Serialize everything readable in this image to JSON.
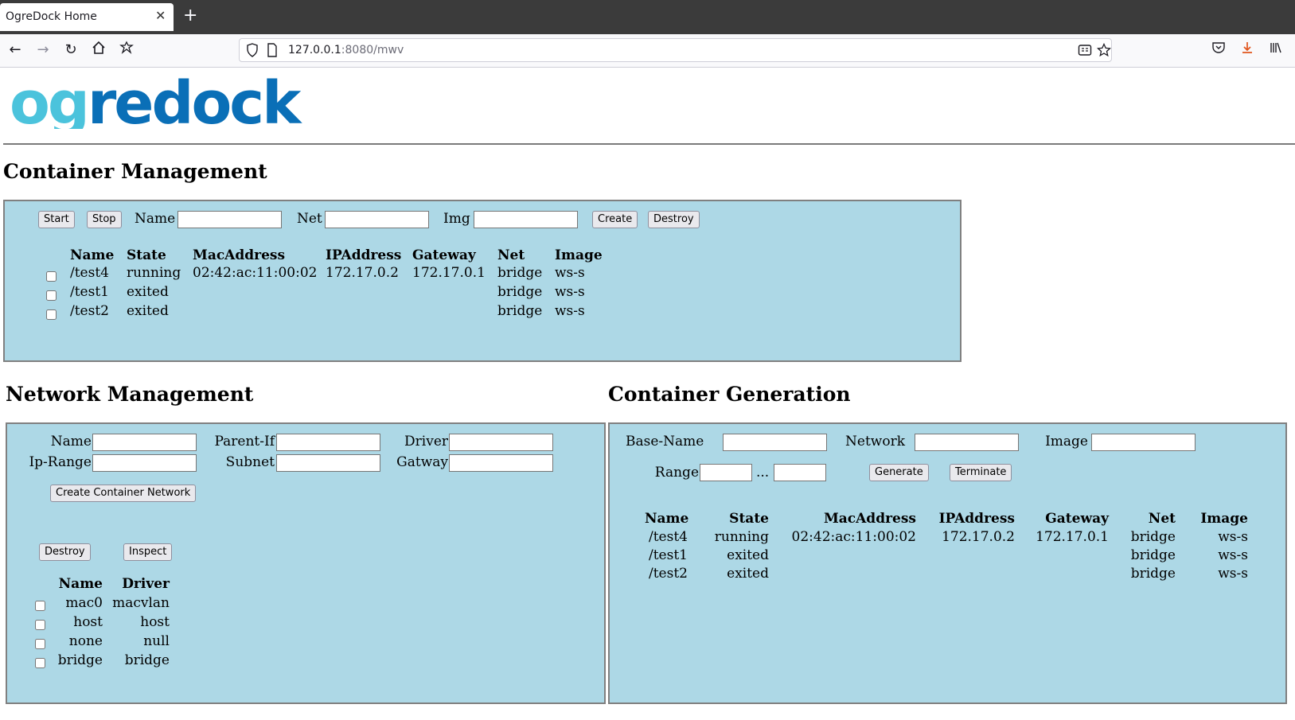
{
  "browser": {
    "tab_title": "OgreDock Home",
    "tab_close": "✕",
    "new_tab": "+",
    "url_host": "127.0.0.1",
    "url_path": ":8080/mwv"
  },
  "logo": {
    "text": "ogredock",
    "color_light": "#4bc3dc",
    "color_dark": "#0a6fb7"
  },
  "container_management": {
    "heading": "Container Management",
    "start_label": "Start",
    "stop_label": "Stop",
    "name_label": "Name",
    "net_label": "Net",
    "img_label": "Img",
    "create_label": "Create",
    "destroy_label": "Destroy",
    "columns": [
      "Name",
      "State",
      "MacAddress",
      "IPAddress",
      "Gateway",
      "Net",
      "Image"
    ],
    "rows": [
      [
        "/test4",
        "running",
        "02:42:ac:11:00:02",
        "172.17.0.2",
        "172.17.0.1",
        "bridge",
        "ws-s"
      ],
      [
        "/test1",
        "exited",
        "",
        "",
        "",
        "bridge",
        "ws-s"
      ],
      [
        "/test2",
        "exited",
        "",
        "",
        "",
        "bridge",
        "ws-s"
      ]
    ]
  },
  "network_management": {
    "heading": "Network Management",
    "name_label": "Name",
    "parent_if_label": "Parent-If",
    "driver_label": "Driver",
    "ip_range_label": "Ip-Range",
    "subnet_label": "Subnet",
    "gatway_label": "Gatway",
    "create_label": "Create Container Network",
    "destroy_label": "Destroy",
    "inspect_label": "Inspect",
    "columns": [
      "Name",
      "Driver"
    ],
    "rows": [
      [
        "mac0",
        "macvlan"
      ],
      [
        "host",
        "host"
      ],
      [
        "none",
        "null"
      ],
      [
        "bridge",
        "bridge"
      ]
    ]
  },
  "container_generation": {
    "heading": "Container Generation",
    "base_name_label": "Base-Name",
    "network_label": "Network",
    "image_label": "Image",
    "range_label": "Range",
    "range_sep": "...",
    "generate_label": "Generate",
    "terminate_label": "Terminate",
    "columns": [
      "Name",
      "State",
      "MacAddress",
      "IPAddress",
      "Gateway",
      "Net",
      "Image"
    ],
    "rows": [
      [
        "/test4",
        "running",
        "02:42:ac:11:00:02",
        "172.17.0.2",
        "172.17.0.1",
        "bridge",
        "ws-s"
      ],
      [
        "/test1",
        "exited",
        "",
        "",
        "",
        "bridge",
        "ws-s"
      ],
      [
        "/test2",
        "exited",
        "",
        "",
        "",
        "bridge",
        "ws-s"
      ]
    ]
  }
}
